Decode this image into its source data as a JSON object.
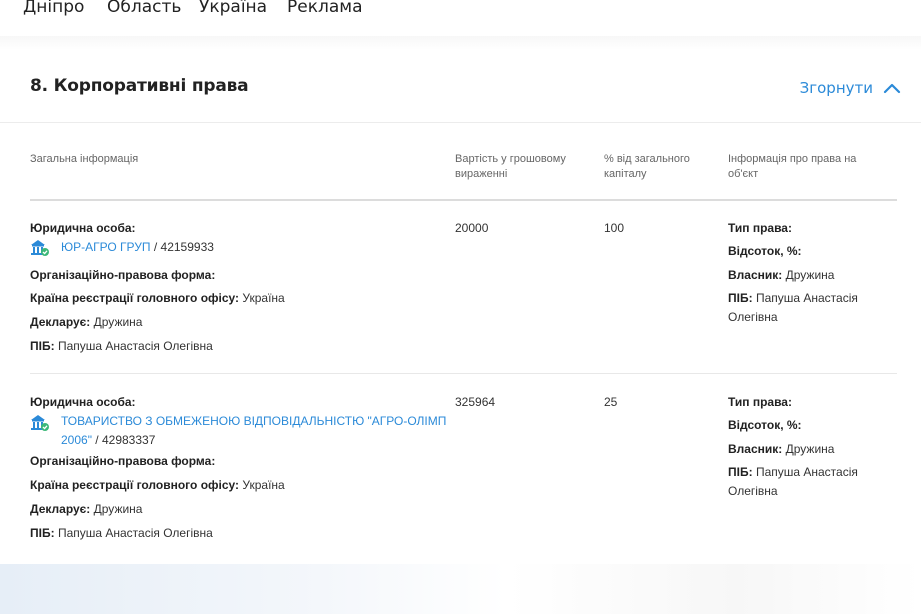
{
  "nav": [
    "Дніпро",
    "Область",
    "Україна",
    "Реклама"
  ],
  "section": {
    "title": "8. Корпоративні права",
    "collapse_label": "Згорнути"
  },
  "columns": [
    "Загальна інформація",
    "Вартість у грошовому вираженні",
    "% від загального капіталу",
    "Інформація про права на об'єкт"
  ],
  "labels": {
    "legal_entity": "Юридична особа:",
    "org_form": "Організаційно-правова форма:",
    "country": "Країна реєстрації головного офісу:",
    "declarant": "Декларує:",
    "pib": "ПІБ:",
    "right_type": "Тип права:",
    "percent": "Відсоток, %:",
    "owner": "Власник:"
  },
  "rows": [
    {
      "company_name": "ЮР-АГРО ГРУП",
      "company_code": " / 42159933",
      "country": "Україна",
      "declarant": "Дружина",
      "pib": "Папуша Анастасія Олегівна",
      "value": "20000",
      "share": "100",
      "owner": "Дружина",
      "owner_pib_1": "Папуша Анастасія",
      "owner_pib_2": "Олегівна"
    },
    {
      "company_name_1": "ТОВАРИСТВО З ОБМЕЖЕНОЮ ВІДПОВІДАЛЬНІСТЮ \"АГРО-ОЛІМП",
      "company_name_2": "2006\"",
      "company_code": " / 42983337",
      "country": "Україна",
      "declarant": "Дружина",
      "pib": "Папуша Анастасія Олегівна",
      "value": "325964",
      "share": "25",
      "owner": "Дружина",
      "owner_pib_1": "Папуша Анастасія",
      "owner_pib_2": "Олегівна"
    }
  ],
  "colors": {
    "link": "#2b8ad8",
    "badge": "#3cb878"
  }
}
